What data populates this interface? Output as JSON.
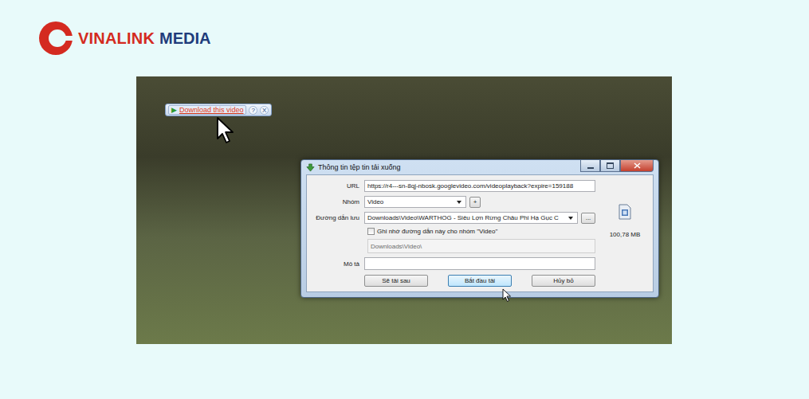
{
  "logo": {
    "brand": "VINALINK",
    "suffix": "MEDIA"
  },
  "video_toolbar": {
    "play_icon": "▶",
    "label": "Download this video",
    "help": "?",
    "close": "X"
  },
  "dialog": {
    "title": "Thông tin tệp tin tải xuống",
    "url": {
      "label": "URL",
      "value": "https://r4---sn-8qj-nbosk.googlevideo.com/videoplayback?expire=159188"
    },
    "group": {
      "label": "Nhóm",
      "value": "Video",
      "add": "+"
    },
    "path": {
      "label": "Đường dẫn lưu",
      "value": "Downloads\\Video\\WARTHOG - Siêu Lợn Rừng Châu Phi Hạ Gục C",
      "browse": "..."
    },
    "remember": {
      "label": "Ghi nhớ đường dẫn này cho nhóm \"Video\"",
      "checked": false
    },
    "default_path": {
      "value": "Downloads\\Video\\",
      "disabled": true
    },
    "description": {
      "label": "Mô tả",
      "value": ""
    },
    "file_size": "100,78 MB",
    "buttons": [
      {
        "label": "Sẽ tải sau",
        "selected": false
      },
      {
        "label": "Bắt đầu tải",
        "selected": true
      },
      {
        "label": "Hủy bỏ",
        "selected": false
      }
    ]
  }
}
